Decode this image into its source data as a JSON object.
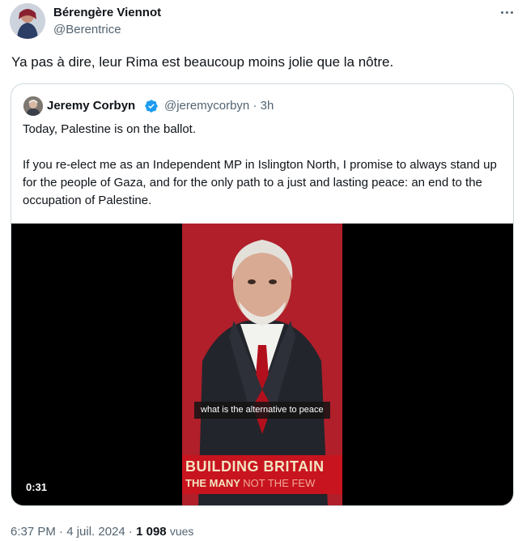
{
  "author": {
    "name": "Bérengère Viennot",
    "handle": "@Berentrice"
  },
  "tweet": {
    "text": "Ya pas à dire, leur Rima est beaucoup moins jolie que la nôtre."
  },
  "quoted": {
    "name": "Jeremy Corbyn",
    "handle": "@jeremycorbyn",
    "time": "· 3h",
    "text": "Today, Palestine is on the ballot.\n\nIf you re-elect me as an Independent MP in Islington North, I promise to always stand up for the people of Gaza, and for the only path to a just and lasting peace: an end to the occupation of Palestine.",
    "video": {
      "caption": "what is the alternative to peace",
      "banner_line1": "BUILDING BRITAIN",
      "banner_line2_strong": "THE MANY",
      "banner_line2_light": "NOT THE FEW",
      "duration": "0:31"
    }
  },
  "meta": {
    "time": "6:37 PM",
    "date": "· 4 juil. 2024 ·",
    "views_count": "1 098",
    "views_label": "vues"
  },
  "colors": {
    "text": "#0f1419",
    "secondary": "#536471",
    "verified": "#1d9bf0",
    "border": "#cfd9de",
    "banner_red": "#c8141e"
  },
  "icons": [
    "more-icon",
    "verified-badge-icon"
  ]
}
